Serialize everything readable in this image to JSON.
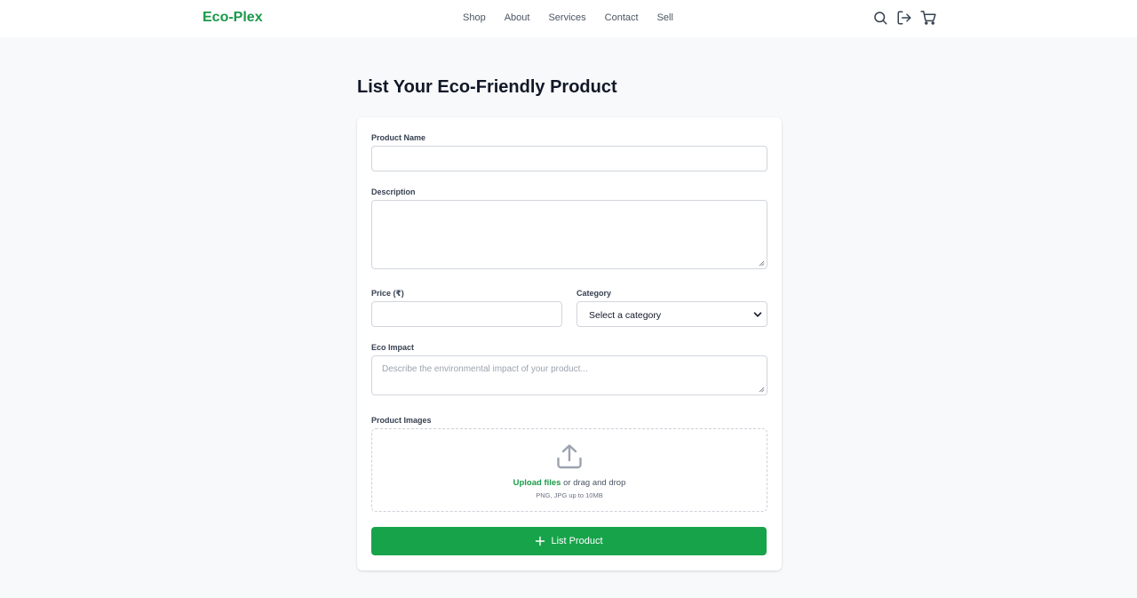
{
  "nav": {
    "brand": "Eco-Plex",
    "links": [
      "Shop",
      "About",
      "Services",
      "Contact",
      "Sell"
    ],
    "icons": [
      "search-icon",
      "logout-icon",
      "cart-icon"
    ]
  },
  "page": {
    "title": "List Your Eco-Friendly Product"
  },
  "form": {
    "product_name": {
      "label": "Product Name",
      "value": ""
    },
    "description": {
      "label": "Description",
      "value": ""
    },
    "price": {
      "label": "Price (₹)",
      "value": ""
    },
    "category": {
      "label": "Category",
      "selected": "Select a category"
    },
    "eco_impact": {
      "label": "Eco Impact",
      "placeholder": "Describe the environmental impact of your product..."
    },
    "images": {
      "label": "Product Images",
      "upload_link": "Upload files",
      "upload_text": " or drag and drop",
      "hint": "PNG, JPG up to 10MB",
      "icon": "upload-icon"
    },
    "submit_label": "List Product"
  },
  "colors": {
    "brand_green": "#1a9a48",
    "button_green": "#17a34a",
    "page_bg": "#f8f9fb"
  }
}
